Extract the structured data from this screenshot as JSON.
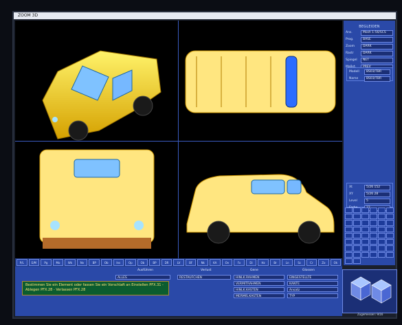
{
  "app": {
    "title": "ZOOM 3D"
  },
  "side_panel": {
    "header": "BEGLEIDEN",
    "fields": [
      {
        "label": "Ans.",
        "value": "Mosh 1:56/SCS"
      },
      {
        "label": "Prog.",
        "value": "BASE"
      },
      {
        "label": "Zoom",
        "value": "DARK"
      },
      {
        "label": "Rastr",
        "value": "DARK"
      },
      {
        "label": "Spiegel",
        "value": "NET"
      },
      {
        "label": "Maßst.",
        "value": "PREV"
      },
      {
        "label": "Modell",
        "value": "BS03/TBR"
      },
      {
        "label": "Name",
        "value": "BS03/TBR"
      }
    ],
    "readouts": [
      {
        "label": "Xt",
        "value": "5/26 152"
      },
      {
        "label": "XY",
        "value": "5/26 28"
      },
      {
        "label": "Level",
        "value": "5"
      },
      {
        "label": "Farbe",
        "value": "22"
      }
    ]
  },
  "palette_tiles": [
    "",
    "",
    "",
    "",
    "",
    "",
    "",
    "",
    "",
    "",
    "",
    "",
    "",
    "",
    "",
    "",
    "",
    "",
    "",
    "",
    "",
    "",
    "",
    "",
    "",
    "",
    "",
    "",
    "",
    "",
    "",
    "",
    "",
    "",
    "",
    "",
    "",
    "",
    "",
    "",
    "",
    "",
    "",
    "",
    "",
    "",
    "",
    "",
    "",
    ""
  ],
  "toolbar": {
    "buttons": [
      "P/L",
      "E/M",
      "Pg",
      "Mo",
      "Wk",
      "Nv",
      "BP",
      "Ob",
      "Ins",
      "Op",
      "Ob",
      "BP",
      "DR",
      "LV",
      "BF",
      "Nk",
      "KA",
      "Ov",
      "Fx",
      "Di",
      "Hz",
      "Br",
      "Ln",
      "Sc",
      "Cr",
      "Zo",
      "Ok"
    ]
  },
  "bottom_panel": {
    "columns": [
      "Ausführen",
      "Verlust",
      "Gene",
      "Glossen"
    ],
    "message": "Bestimmen Sie ein Element oder fassen Sie ein Vorschlaft an   Einstellen PFX.31 - Ablegen PFX.28 - Verlassen PFX.28",
    "fields": {
      "col1": [
        "ALLES",
        "",
        ""
      ],
      "col2": [
        "RESTAUFCHEN",
        "",
        ""
      ],
      "col3": [
        "HINLK.RAHMEN",
        "VERMITRAHMEN",
        "HINLK.KASTEN",
        "MERMIS.KASTEN"
      ],
      "col4": [
        "EINGESTELLTE",
        "KANTE",
        "Ansatz",
        "TYP"
      ]
    }
  },
  "status_text": "Zugemessen: 9/16"
}
